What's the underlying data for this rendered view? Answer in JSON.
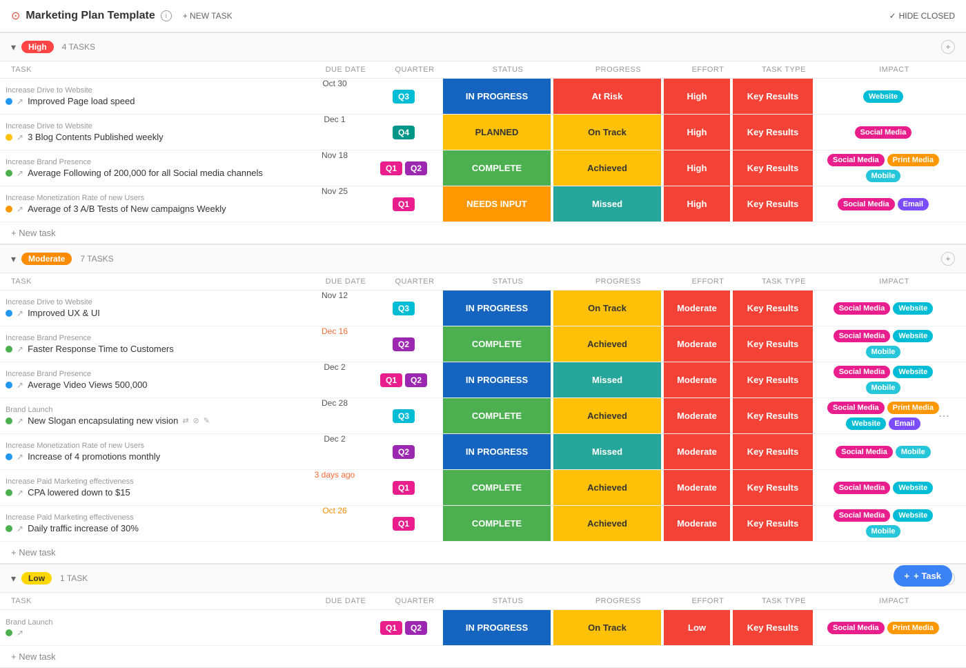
{
  "header": {
    "title": "Marketing Plan Template",
    "new_task_label": "+ NEW TASK",
    "hide_closed_label": "HIDE CLOSED"
  },
  "columns": {
    "task": "TASK",
    "due_date": "DUE DATE",
    "quarter": "QUARTER",
    "status": "STATUS",
    "progress": "PROGRESS",
    "effort": "EFFORT",
    "task_type": "TASK TYPE",
    "impact": "IMPACT"
  },
  "groups": [
    {
      "id": "high",
      "priority": "High",
      "priority_class": "priority-high",
      "task_count": "4 TASKS",
      "tasks": [
        {
          "id": 1,
          "subtitle": "Increase Drive to Website",
          "name": "Improved Page load speed",
          "dot": "dot-blue",
          "due": "Oct 30",
          "due_class": "",
          "quarters": [
            {
              "label": "Q3",
              "class": "q3"
            }
          ],
          "status": "IN PROGRESS",
          "status_class": "status-inprogress",
          "progress": "At Risk",
          "progress_class": "prog-atrisk",
          "effort": "High",
          "tasktype": "Key Results",
          "impact_tags": [
            {
              "label": "Website",
              "class": "tag-website"
            }
          ]
        },
        {
          "id": 2,
          "subtitle": "Increase Drive to Website",
          "name": "3 Blog Contents Published weekly",
          "dot": "dot-yellow",
          "due": "Dec 1",
          "due_class": "",
          "quarters": [
            {
              "label": "Q4",
              "class": "q4"
            }
          ],
          "status": "PLANNED",
          "status_class": "status-planned",
          "progress": "On Track",
          "progress_class": "prog-ontrack",
          "effort": "High",
          "tasktype": "Key Results",
          "impact_tags": [
            {
              "label": "Social Media",
              "class": "tag-social"
            }
          ]
        },
        {
          "id": 3,
          "subtitle": "Increase Brand Presence",
          "name": "Average Following of 200,000 for all Social media channels",
          "dot": "dot-green",
          "due": "Nov 18",
          "due_class": "",
          "quarters": [
            {
              "label": "Q1",
              "class": "q1"
            },
            {
              "label": "Q2",
              "class": "q2"
            }
          ],
          "status": "COMPLETE",
          "status_class": "status-complete",
          "progress": "Achieved",
          "progress_class": "prog-achieved",
          "effort": "High",
          "tasktype": "Key Results",
          "impact_tags": [
            {
              "label": "Social Media",
              "class": "tag-social"
            },
            {
              "label": "Print Media",
              "class": "tag-printmedia"
            },
            {
              "label": "Mobile",
              "class": "tag-mobile"
            }
          ]
        },
        {
          "id": 4,
          "subtitle": "Increase Monetization Rate of new Users",
          "name": "Average of 3 A/B Tests of New campaigns Weekly",
          "dot": "dot-orange",
          "due": "Nov 25",
          "due_class": "",
          "quarters": [
            {
              "label": "Q1",
              "class": "q1"
            }
          ],
          "status": "NEEDS INPUT",
          "status_class": "status-needsinput",
          "progress": "Missed",
          "progress_class": "prog-missed",
          "effort": "High",
          "tasktype": "Key Results",
          "impact_tags": [
            {
              "label": "Social Media",
              "class": "tag-social"
            },
            {
              "label": "Email",
              "class": "tag-email"
            }
          ]
        }
      ],
      "add_task_label": "+ New task"
    },
    {
      "id": "moderate",
      "priority": "Moderate",
      "priority_class": "priority-moderate",
      "task_count": "7 TASKS",
      "tasks": [
        {
          "id": 5,
          "subtitle": "Increase Drive to Website",
          "name": "Improved UX & UI",
          "dot": "dot-blue",
          "due": "Nov 12",
          "due_class": "",
          "quarters": [
            {
              "label": "Q3",
              "class": "q3"
            }
          ],
          "status": "IN PROGRESS",
          "status_class": "status-inprogress",
          "progress": "On Track",
          "progress_class": "prog-ontrack",
          "effort": "Moderate",
          "tasktype": "Key Results",
          "impact_tags": [
            {
              "label": "Social Media",
              "class": "tag-social"
            },
            {
              "label": "Website",
              "class": "tag-website"
            }
          ]
        },
        {
          "id": 6,
          "subtitle": "Increase Brand Presence",
          "name": "Faster Response Time to Customers",
          "dot": "dot-green",
          "due": "Dec 16",
          "due_class": "due-overdue",
          "quarters": [
            {
              "label": "Q2",
              "class": "q2"
            }
          ],
          "status": "COMPLETE",
          "status_class": "status-complete",
          "progress": "Achieved",
          "progress_class": "prog-achieved",
          "effort": "Moderate",
          "tasktype": "Key Results",
          "impact_tags": [
            {
              "label": "Social Media",
              "class": "tag-social"
            },
            {
              "label": "Website",
              "class": "tag-website"
            },
            {
              "label": "Mobile",
              "class": "tag-mobile"
            }
          ]
        },
        {
          "id": 7,
          "subtitle": "Increase Brand Presence",
          "name": "Average Video Views 500,000",
          "dot": "dot-blue",
          "due": "Dec 2",
          "due_class": "",
          "quarters": [
            {
              "label": "Q1",
              "class": "q1"
            },
            {
              "label": "Q2",
              "class": "q2"
            }
          ],
          "status": "IN PROGRESS",
          "status_class": "status-inprogress",
          "progress": "Missed",
          "progress_class": "prog-missed",
          "effort": "Moderate",
          "tasktype": "Key Results",
          "impact_tags": [
            {
              "label": "Social Media",
              "class": "tag-social"
            },
            {
              "label": "Website",
              "class": "tag-website"
            },
            {
              "label": "Mobile",
              "class": "tag-mobile"
            }
          ]
        },
        {
          "id": 8,
          "subtitle": "Brand Launch",
          "name": "New Slogan encapsulating new vision",
          "dot": "dot-green",
          "due": "Dec 28",
          "due_class": "",
          "quarters": [
            {
              "label": "Q3",
              "class": "q3"
            }
          ],
          "status": "COMPLETE",
          "status_class": "status-complete",
          "progress": "Achieved",
          "progress_class": "prog-achieved",
          "effort": "Moderate",
          "tasktype": "Key Results",
          "impact_tags": [
            {
              "label": "Social Media",
              "class": "tag-social"
            },
            {
              "label": "Print Media",
              "class": "tag-printmedia"
            },
            {
              "label": "Website",
              "class": "tag-website"
            },
            {
              "label": "Email",
              "class": "tag-email"
            }
          ],
          "highlighted": true
        },
        {
          "id": 9,
          "subtitle": "Increase Monetization Rate of new Users",
          "name": "Increase of 4 promotions monthly",
          "dot": "dot-blue",
          "due": "Dec 2",
          "due_class": "",
          "quarters": [
            {
              "label": "Q2",
              "class": "q2"
            }
          ],
          "status": "IN PROGRESS",
          "status_class": "status-inprogress",
          "progress": "Missed",
          "progress_class": "prog-missed",
          "effort": "Moderate",
          "tasktype": "Key Results",
          "impact_tags": [
            {
              "label": "Social Media",
              "class": "tag-social"
            },
            {
              "label": "Mobile",
              "class": "tag-mobile"
            }
          ]
        },
        {
          "id": 10,
          "subtitle": "Increase Paid Marketing effectiveness",
          "name": "CPA lowered down to $15",
          "dot": "dot-green",
          "due": "3 days ago",
          "due_class": "due-overdue",
          "quarters": [
            {
              "label": "Q1",
              "class": "q1"
            }
          ],
          "status": "COMPLETE",
          "status_class": "status-complete",
          "progress": "Achieved",
          "progress_class": "prog-achieved",
          "effort": "Moderate",
          "tasktype": "Key Results",
          "impact_tags": [
            {
              "label": "Social Media",
              "class": "tag-social"
            },
            {
              "label": "Website",
              "class": "tag-website"
            }
          ]
        },
        {
          "id": 11,
          "subtitle": "Increase Paid Marketing effectiveness",
          "name": "Daily traffic increase of 30%",
          "dot": "dot-green",
          "due": "Oct 26",
          "due_class": "due-soon",
          "quarters": [
            {
              "label": "Q1",
              "class": "q1"
            }
          ],
          "status": "COMPLETE",
          "status_class": "status-complete",
          "progress": "Achieved",
          "progress_class": "prog-achieved",
          "effort": "Moderate",
          "tasktype": "Key Results",
          "impact_tags": [
            {
              "label": "Social Media",
              "class": "tag-social"
            },
            {
              "label": "Website",
              "class": "tag-website"
            },
            {
              "label": "Mobile",
              "class": "tag-mobile"
            }
          ]
        }
      ],
      "add_task_label": "+ New task"
    },
    {
      "id": "low",
      "priority": "Low",
      "priority_class": "priority-low",
      "task_count": "1 TASK",
      "tasks": [
        {
          "id": 12,
          "subtitle": "Brand Launch",
          "name": "",
          "dot": "dot-green",
          "due": "",
          "due_class": "",
          "quarters": [
            {
              "label": "Q1",
              "class": "q1"
            },
            {
              "label": "Q2",
              "class": "q2"
            }
          ],
          "status": "IN PROGRESS",
          "status_class": "status-inprogress",
          "progress": "On Track",
          "progress_class": "prog-ontrack",
          "effort": "Low",
          "tasktype": "Key Results",
          "impact_tags": [
            {
              "label": "Social Media",
              "class": "tag-social"
            },
            {
              "label": "Print Media",
              "class": "tag-printmedia"
            }
          ]
        }
      ],
      "add_task_label": "+ New task"
    }
  ],
  "floating_button": {
    "label": "+ Task"
  }
}
